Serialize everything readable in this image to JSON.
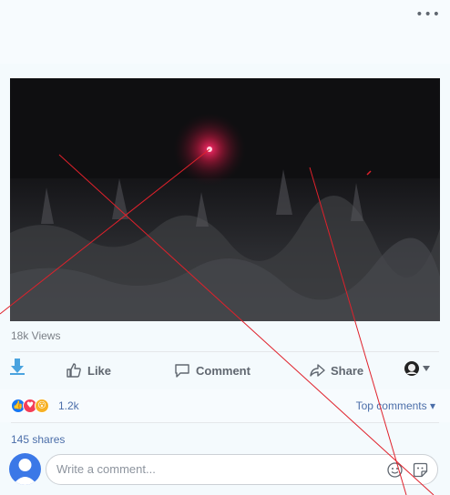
{
  "header": {
    "more_icon": "more-options-icon",
    "more_glyph": "•••"
  },
  "video": {
    "views": "18k Views"
  },
  "actions": {
    "like_label": "Like",
    "comment_label": "Comment",
    "share_label": "Share"
  },
  "reactions": {
    "icons": [
      "like-reaction-icon",
      "love-reaction-icon",
      "wow-reaction-icon"
    ],
    "count": "1.2k",
    "sort_label": "Top comments ▾"
  },
  "shares": {
    "label": "145 shares"
  },
  "comment_box": {
    "placeholder": "Write a comment..."
  },
  "colors": {
    "accent_blue": "#4b6ea9",
    "like_blue": "#1877f2",
    "love_red": "#f33e58",
    "wow_yellow": "#f7b125",
    "laser_red": "#e0212b"
  }
}
